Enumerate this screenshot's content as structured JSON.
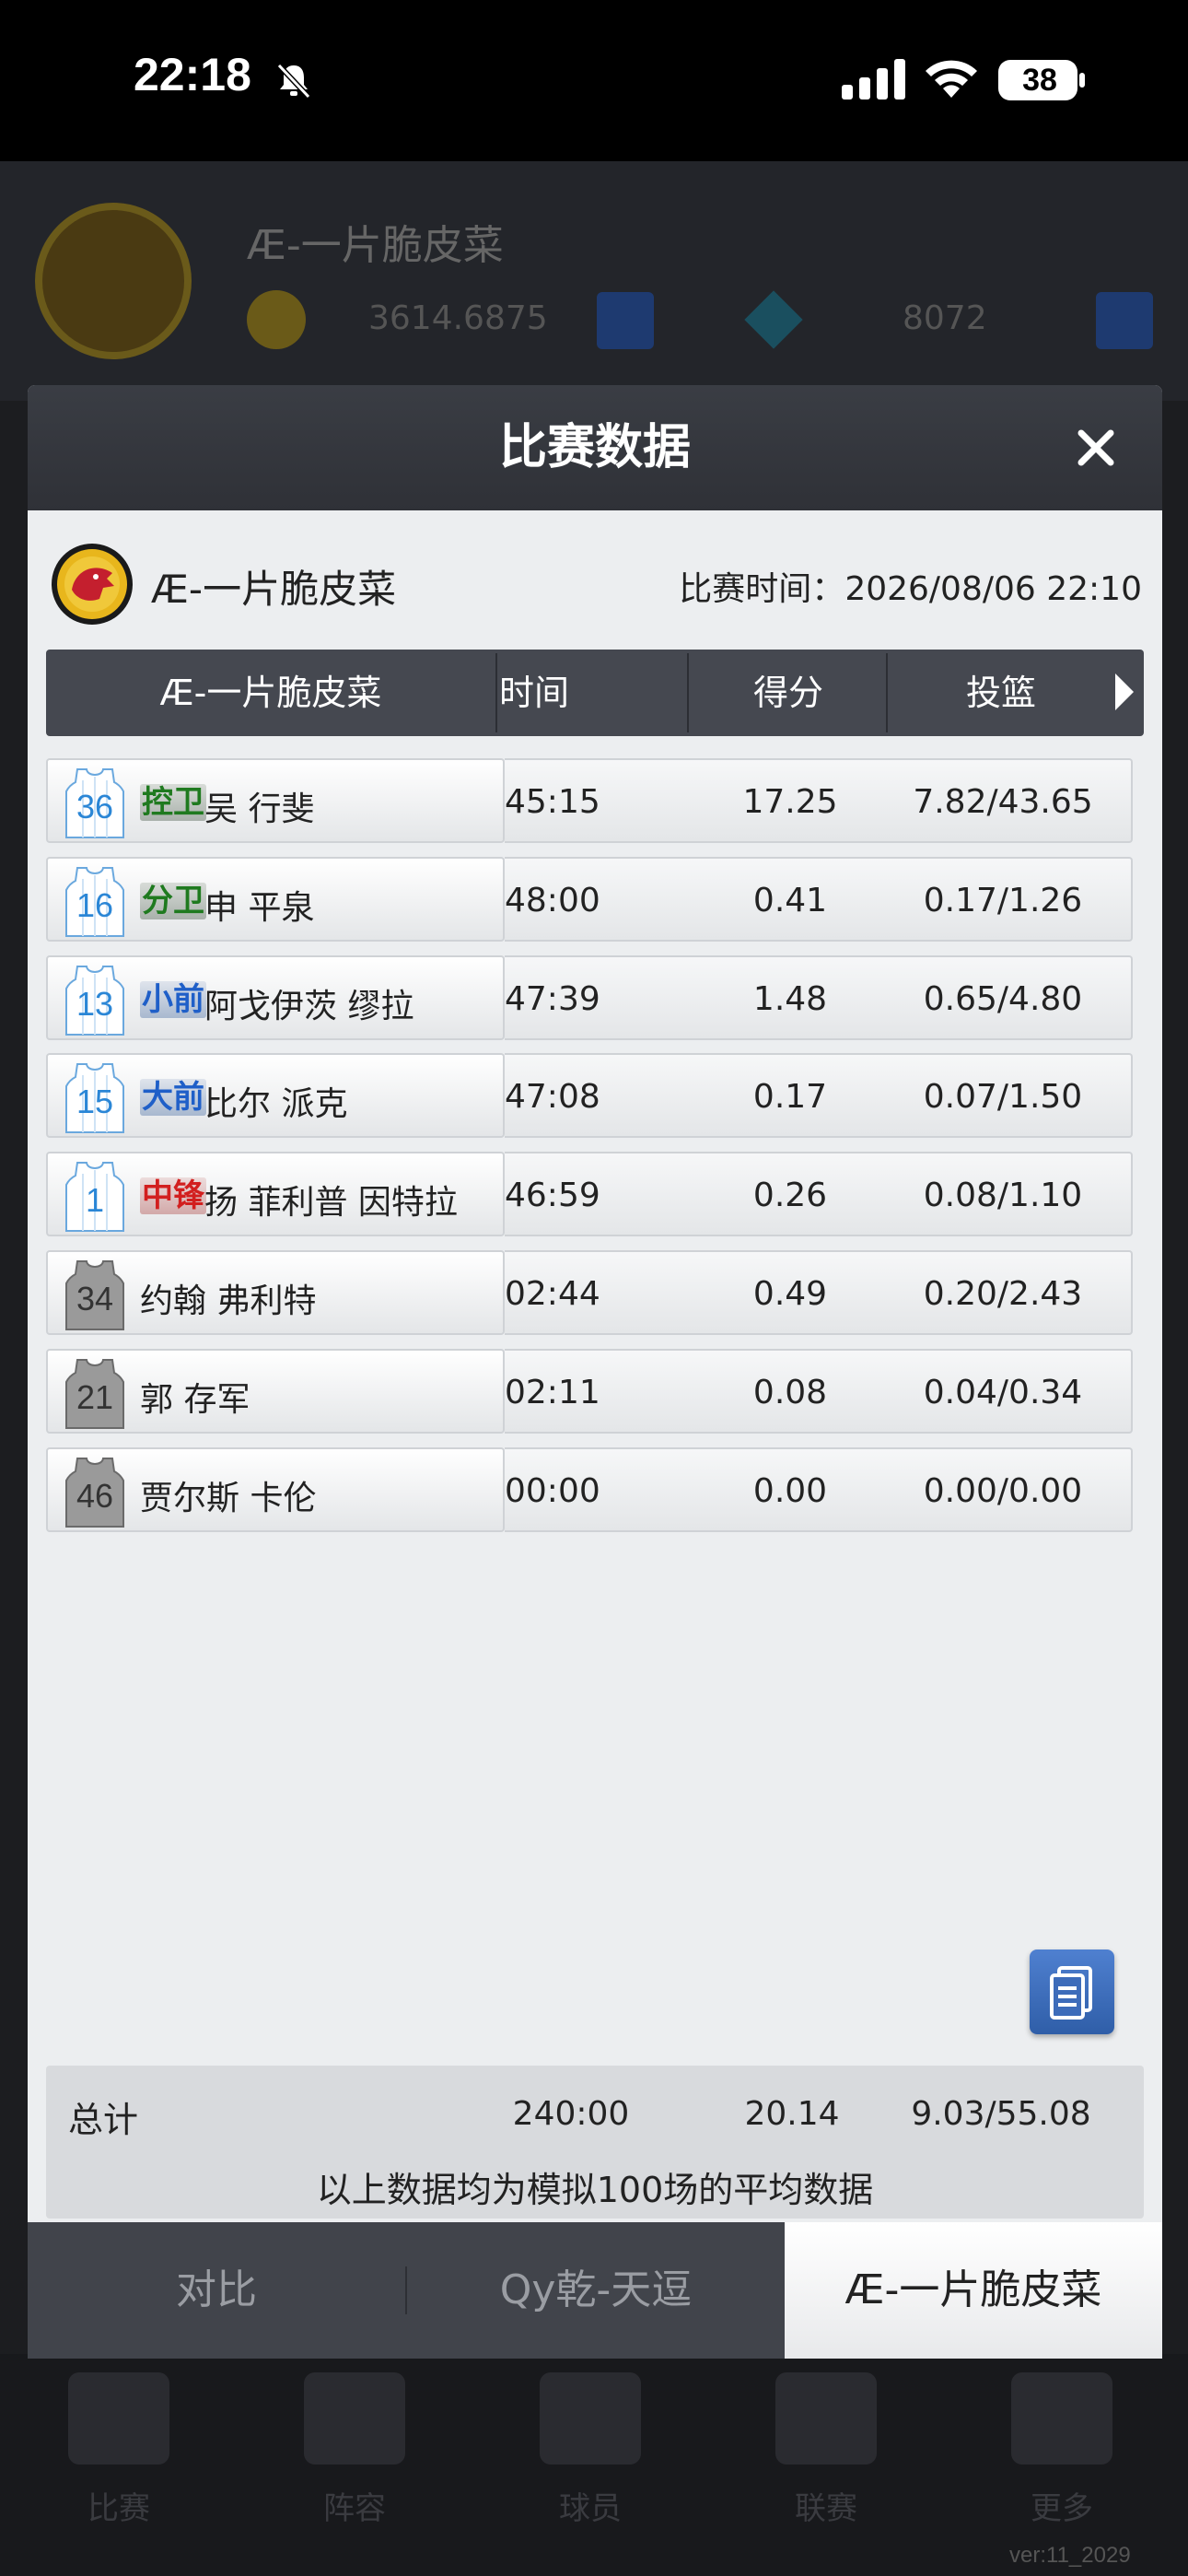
{
  "status_bar": {
    "time": "22:18",
    "battery": "38"
  },
  "background": {
    "team_name": "Æ-一片脆皮菜",
    "coins": "3614.6875",
    "gems": "8072",
    "nav_labels": [
      "比赛",
      "阵容",
      "球员",
      "联赛",
      "更多"
    ],
    "version": "ver:11_2029"
  },
  "modal": {
    "title": "比赛数据",
    "team_name": "Æ-一片脆皮菜",
    "match_time_label": "比赛时间：",
    "match_time": "2026/08/06 22:10",
    "columns": [
      "Æ-一片脆皮菜",
      "时间",
      "得分",
      "投篮"
    ],
    "players": [
      {
        "number": "36",
        "starter": true,
        "position": "控卫",
        "pos_type": "g",
        "name": "吴 行斐",
        "time": "45:15",
        "points": "17.25",
        "shooting": "7.82/43.65"
      },
      {
        "number": "16",
        "starter": true,
        "position": "分卫",
        "pos_type": "g",
        "name": "申 平泉",
        "time": "48:00",
        "points": "0.41",
        "shooting": "0.17/1.26"
      },
      {
        "number": "13",
        "starter": true,
        "position": "小前",
        "pos_type": "f",
        "name": "阿戈伊茨 缪拉",
        "time": "47:39",
        "points": "1.48",
        "shooting": "0.65/4.80"
      },
      {
        "number": "15",
        "starter": true,
        "position": "大前",
        "pos_type": "f",
        "name": "比尔 派克",
        "time": "47:08",
        "points": "0.17",
        "shooting": "0.07/1.50"
      },
      {
        "number": "1",
        "starter": true,
        "position": "中锋",
        "pos_type": "c",
        "name": "扬 菲利普 因特拉",
        "time": "46:59",
        "points": "0.26",
        "shooting": "0.08/1.10"
      },
      {
        "number": "34",
        "starter": false,
        "position": "",
        "pos_type": "",
        "name": "约翰 弗利特",
        "time": "02:44",
        "points": "0.49",
        "shooting": "0.20/2.43"
      },
      {
        "number": "21",
        "starter": false,
        "position": "",
        "pos_type": "",
        "name": "郭 存军",
        "time": "02:11",
        "points": "0.08",
        "shooting": "0.04/0.34"
      },
      {
        "number": "46",
        "starter": false,
        "position": "",
        "pos_type": "",
        "name": "贾尔斯 卡伦",
        "time": "00:00",
        "points": "0.00",
        "shooting": "0.00/0.00"
      }
    ],
    "totals": {
      "label": "总计",
      "time": "240:00",
      "points": "20.14",
      "shooting": "9.03/55.08",
      "note": "以上数据均为模拟100场的平均数据"
    },
    "tabs": [
      "对比",
      "Qy乾-天逗",
      "Æ-一片脆皮菜"
    ],
    "active_tab": 2
  },
  "colors": {
    "guard": "#1f7a1f",
    "forward": "#1f5fc8",
    "center": "#d21f1f",
    "jersey_starter": "#2a86d6",
    "jersey_bench": "#8a8a8a"
  }
}
